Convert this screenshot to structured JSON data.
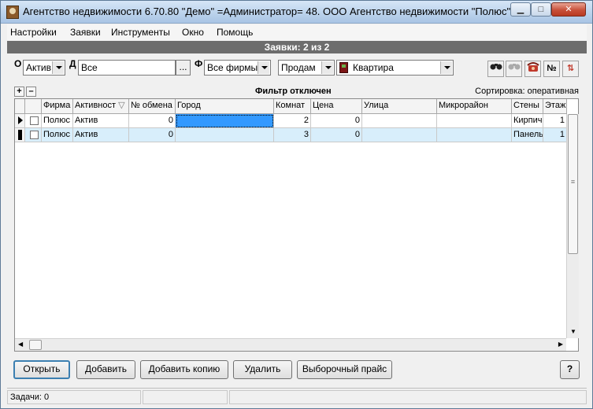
{
  "window": {
    "title": "Агентство недвижимости 6.70.80 \"Демо\" =Администратор= 48. ООО Агентство недвижимости \"Полюс\"",
    "min_label": "▁",
    "max_label": "□",
    "close_label": "✕"
  },
  "menu": [
    "Настройки",
    "Заявки",
    "Инструменты",
    "Окно",
    "Помощь"
  ],
  "caption": "Заявки: 2 из 2",
  "filters": {
    "o_label": "О",
    "o_value": "Актив",
    "d_label": "Д",
    "d_value": "Все",
    "dots_label": "...",
    "f_label": "Ф",
    "f_value": "Все фирмы",
    "deal_value": "Продам",
    "type_value": "Квартира"
  },
  "toolbar": {
    "number_label": "№",
    "sort_label": "⇅"
  },
  "grid_top": {
    "plus": "+",
    "minus": "–",
    "filter_status": "Фильтр отключен",
    "sort_status": "Сортировка: оперативная"
  },
  "grid": {
    "columns": [
      "Фирма",
      "Активност",
      "№ обмена",
      "Город",
      "Комнат",
      "Цена",
      "Улица",
      "Микрорайон",
      "Стены",
      "Этаж"
    ],
    "rows": [
      [
        "Полюс",
        "Актив",
        "0",
        "",
        "2",
        "0",
        "",
        "",
        "Кирпич",
        "1"
      ],
      [
        "Полюс",
        "Актив",
        "0",
        "",
        "3",
        "0",
        "",
        "",
        "Панель",
        "1"
      ]
    ]
  },
  "buttons": {
    "open": "Открыть",
    "add": "Добавить",
    "add_copy": "Добавить копию",
    "delete": "Удалить",
    "price": "Выборочный прайс",
    "help": "?"
  },
  "status": {
    "tasks": "Задачи: 0"
  }
}
